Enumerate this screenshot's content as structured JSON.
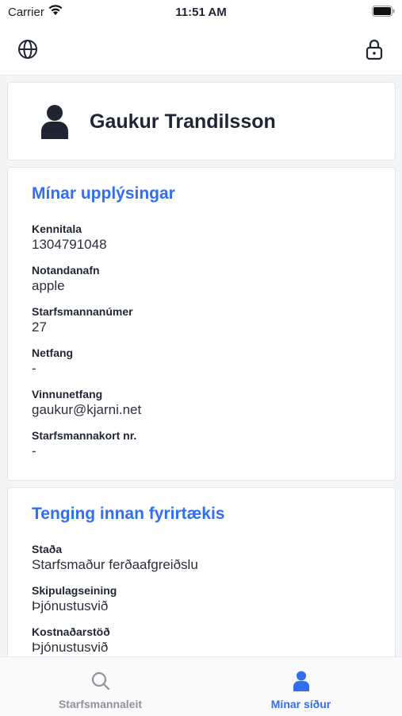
{
  "status_bar": {
    "carrier": "Carrier",
    "time": "11:51 AM"
  },
  "top_bar": {
    "language_icon": "globe-icon",
    "lock_icon": "lock-icon"
  },
  "profile": {
    "name": "Gaukur Trandilsson",
    "avatar_icon": "person-icon"
  },
  "info_card": {
    "title": "Mínar upplýsingar",
    "fields": [
      {
        "label": "Kennitala",
        "value": "1304791048"
      },
      {
        "label": "Notandanafn",
        "value": "apple"
      },
      {
        "label": "Starfsmannanúmer",
        "value": "27"
      },
      {
        "label": "Netfang",
        "value": "-"
      },
      {
        "label": "Vinnunetfang",
        "value": "gaukur@kjarni.net"
      },
      {
        "label": "Starfsmannakort nr.",
        "value": "-"
      }
    ]
  },
  "company_card": {
    "title": "Tenging innan fyrirtækis",
    "fields": [
      {
        "label": "Staða",
        "value": "Starfsmaður ferðaafgreiðslu"
      },
      {
        "label": "Skipulagseining",
        "value": "Þjónustusvið"
      },
      {
        "label": "Kostnaðarstöð",
        "value": "Þjónustusvið"
      }
    ]
  },
  "tab_bar": {
    "tabs": [
      {
        "label": "Starfsmannaleit",
        "icon": "search-icon",
        "active": false
      },
      {
        "label": "Mínar síður",
        "icon": "person-icon",
        "active": true
      }
    ],
    "active_color": "#2f6ff0",
    "inactive_color": "#8e939c"
  },
  "colors": {
    "accent": "#2f6ff0",
    "text_dark": "#1f2533",
    "background": "#f4f5f7"
  }
}
